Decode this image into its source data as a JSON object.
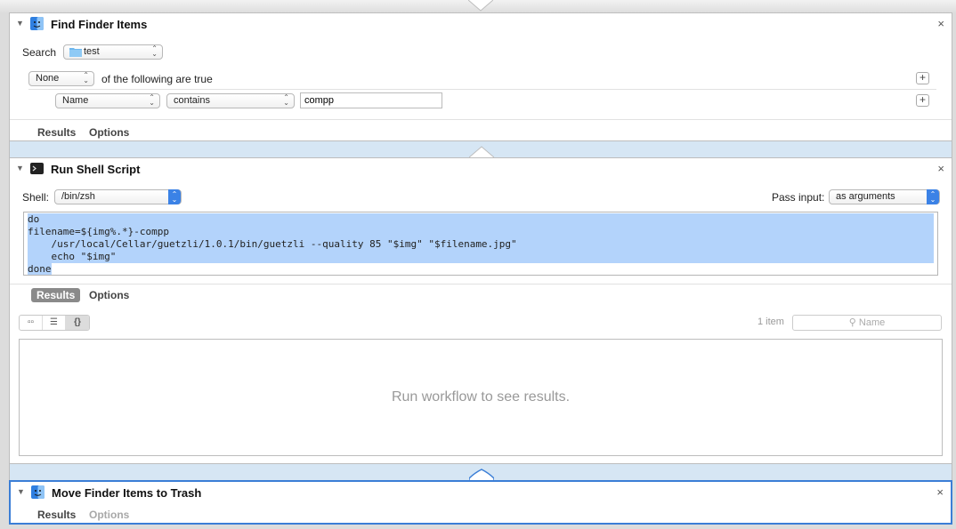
{
  "find_finder_items": {
    "title": "Find Finder Items",
    "close": "×",
    "search_label": "Search",
    "search_location": "test",
    "quantifier": "None",
    "quantifier_suffix": "of the following are true",
    "condition": {
      "field": "Name",
      "operator": "contains",
      "value": "compp"
    },
    "plus": "+",
    "tabs": [
      "Results",
      "Options"
    ]
  },
  "run_shell_script": {
    "title": "Run Shell Script",
    "close": "×",
    "shell_label": "Shell:",
    "shell_value": "/bin/zsh",
    "pass_input_label": "Pass input:",
    "pass_input_value": "as arguments",
    "code_lines": [
      "do",
      "filename=${img%.*}-compp",
      "    /usr/local/Cellar/guetzli/1.0.1/bin/guetzli --quality 85 \"$img\" \"$filename.jpg\"",
      "    echo \"$img\"",
      "done"
    ],
    "tabs": [
      "Results",
      "Options"
    ],
    "view_icons": [
      "icon-view",
      "list-view",
      "code-view"
    ],
    "item_count": "1 item",
    "search_placeholder": "Name",
    "results_message": "Run workflow to see results."
  },
  "move_to_trash": {
    "title": "Move Finder Items to Trash",
    "close": "×",
    "tabs": [
      "Results",
      "Options"
    ]
  },
  "colors": {
    "accent": "#3b7ed6",
    "selection": "#b3d3fb",
    "connector": "#d6e6f4"
  }
}
